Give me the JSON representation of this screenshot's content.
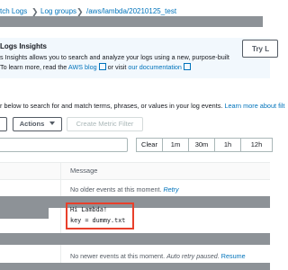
{
  "breadcrumb": {
    "items": [
      "tch Logs",
      "Log groups",
      "/aws/lambda/20210125_test"
    ]
  },
  "insights_banner": {
    "title": "Logs Insights",
    "line1": "s Insights allows you to search and analyze your logs using a new, purpose-built",
    "line2_prefix": "To learn more, read the ",
    "blog_link": "AWS blog",
    "line2_middle": " or visit ",
    "doc_link": "our documentation",
    "try_button": "Try L"
  },
  "filter_description": {
    "text": "r below to search for and match terms, phrases, or values in your log events. ",
    "link": "Learn more about filt"
  },
  "toolbar": {
    "actions_label": "Actions",
    "create_metric_label": "Create Metric Filter"
  },
  "time_range": {
    "options": [
      "Clear",
      "1m",
      "30m",
      "1h",
      "12h"
    ]
  },
  "table": {
    "message_header": "Message",
    "older_text": "No older events at this moment. ",
    "retry_label": "Retry",
    "messages": [
      "Hi Lambda!",
      "key = dummy.txt"
    ],
    "newer_text": "No newer events at this moment. ",
    "auto_retry_text": "Auto retry paused. ",
    "resume_label": "Resume"
  },
  "colors": {
    "link": "#0073bb",
    "highlight": "#e8402b",
    "redaction": "#8d9297",
    "banner_bg": "#f2f8fd"
  }
}
